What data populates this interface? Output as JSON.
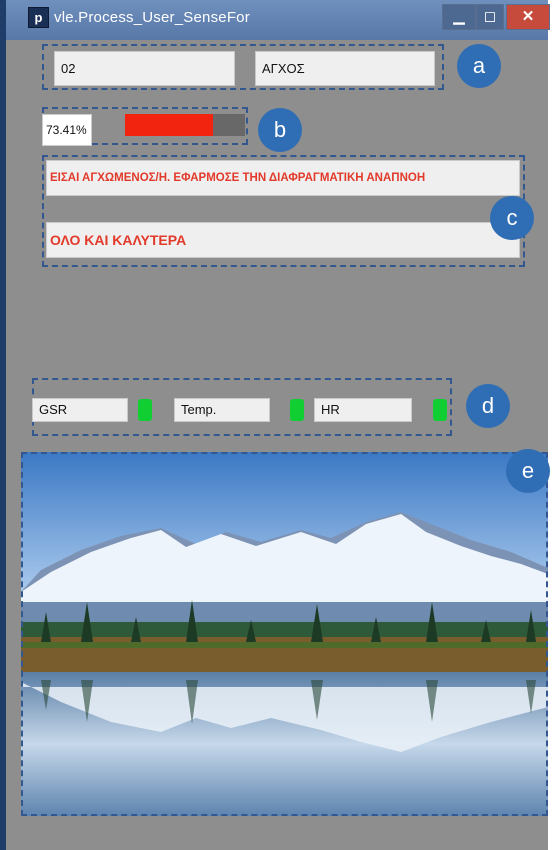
{
  "window": {
    "title": "vle.Process_User_SenseFor",
    "icon_letter": "p",
    "controls": {
      "minimize": "▁",
      "maximize": "◻",
      "close": "✕"
    }
  },
  "user": {
    "id": "02",
    "state": "ΑΓΧΟΣ"
  },
  "stress": {
    "value_text": "73.41%",
    "level": 0.7341,
    "bar_color": "#f22410"
  },
  "messages": {
    "line1": "ΕΙΣΑΙ  ΑΓΧΩΜΕΝΟΣ/Η. ΕΦΑΡΜΟΣΕ ΤΗΝ ΔΙΑΦΡΑΓΜΑΤΙΚΗ ΑΝΑΠΝΟΗ",
    "line2": "ΟΛΟ ΚΑΙ ΚΑΛΥΤΕΡΑ"
  },
  "sensors": [
    {
      "label": "GSR",
      "status": "green"
    },
    {
      "label": "Temp.",
      "status": "green"
    },
    {
      "label": "HR",
      "status": "green"
    }
  ],
  "annotations": {
    "a": "a",
    "b": "b",
    "c": "c",
    "d": "d",
    "e": "e"
  },
  "scene": {
    "content": "mountain-lake-landscape"
  },
  "colors": {
    "accent": "#2f6db5",
    "led_on": "#11cf33",
    "message": "#e23a2a"
  }
}
